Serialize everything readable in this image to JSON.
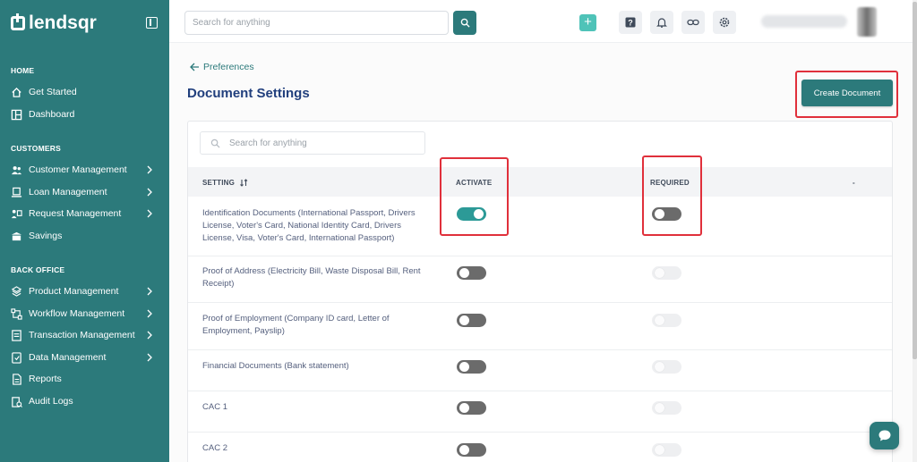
{
  "app": {
    "brand": "lendsqr"
  },
  "sidebar": {
    "sections": {
      "home": "HOME",
      "customers": "CUSTOMERS",
      "back_office": "BACK OFFICE"
    },
    "items": [
      {
        "label": "Get Started",
        "icon": "home-icon"
      },
      {
        "label": "Dashboard",
        "icon": "dashboard-icon"
      },
      {
        "label": "Customer Management",
        "icon": "users-icon"
      },
      {
        "label": "Loan Management",
        "icon": "loan-icon"
      },
      {
        "label": "Request Management",
        "icon": "request-icon"
      },
      {
        "label": "Savings",
        "icon": "savings-icon"
      },
      {
        "label": "Product Management",
        "icon": "product-icon"
      },
      {
        "label": "Workflow Management",
        "icon": "workflow-icon"
      },
      {
        "label": "Transaction Management",
        "icon": "transaction-icon"
      },
      {
        "label": "Data Management",
        "icon": "data-icon"
      },
      {
        "label": "Reports",
        "icon": "reports-icon"
      },
      {
        "label": "Audit Logs",
        "icon": "audit-icon"
      }
    ]
  },
  "topbar": {
    "search_placeholder": "Search for anything"
  },
  "main": {
    "breadcrumb": "Preferences",
    "title": "Document Settings",
    "create_button": "Create Document",
    "table_search_placeholder": "Search for anything",
    "columns": {
      "setting": "SETTING",
      "activate": "ACTIVATE",
      "required": "REQUIRED",
      "extra": "-"
    },
    "rows": [
      {
        "label": "Identification Documents (International Passport, Drivers License, Voter's Card, National Identity Card, Drivers License, Visa, Voter's Card, International Passport)",
        "activate": true,
        "required": false
      },
      {
        "label": "Proof of Address (Electricity Bill, Waste Disposal Bill, Rent Receipt)",
        "activate": false,
        "required": false
      },
      {
        "label": "Proof of Employment (Company ID card, Letter of Employment, Payslip)",
        "activate": false,
        "required": false
      },
      {
        "label": "Financial Documents (Bank statement)",
        "activate": false,
        "required": false
      },
      {
        "label": "CAC 1",
        "activate": false,
        "required": false
      },
      {
        "label": "CAC 2",
        "activate": false,
        "required": false
      }
    ]
  },
  "colors": {
    "primary": "#2c7a7b",
    "title": "#213f7d",
    "highlight": "#e0303b"
  }
}
